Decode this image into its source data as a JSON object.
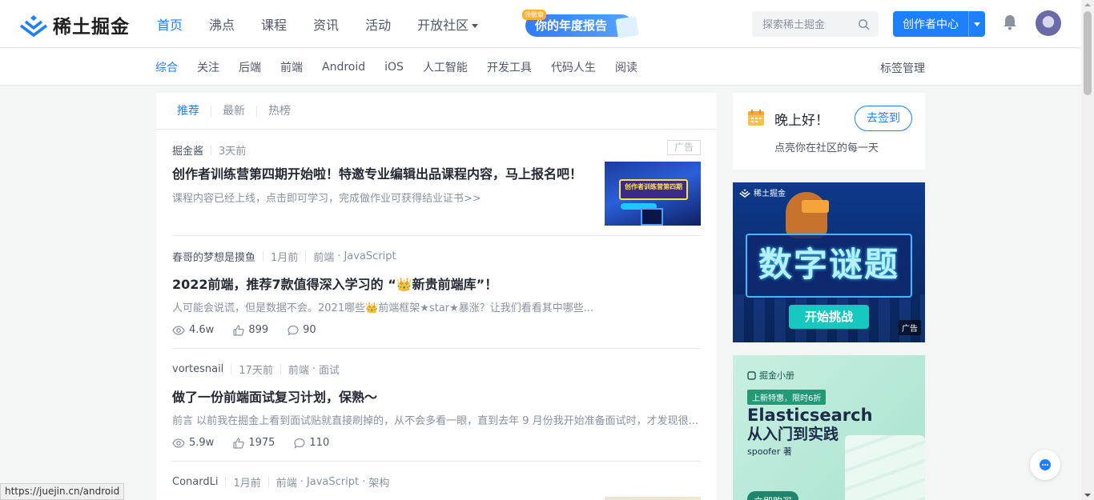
{
  "header": {
    "logo_text": "稀土掘金",
    "nav": [
      {
        "label": "首页",
        "active": true
      },
      {
        "label": "沸点",
        "active": false
      },
      {
        "label": "课程",
        "active": false
      },
      {
        "label": "资讯",
        "active": false
      },
      {
        "label": "活动",
        "active": false
      },
      {
        "label": "开放社区",
        "active": false,
        "dropdown": true
      }
    ],
    "year_report": {
      "badge": "领徽章",
      "label": "你的年度报告"
    },
    "search": {
      "placeholder": "探索稀土掘金",
      "icon": "search-icon"
    },
    "creator_button": "创作者中心",
    "notification_icon": "bell-icon",
    "accent_color": "#1e80ff"
  },
  "subnav": {
    "tags": [
      {
        "label": "综合",
        "active": true
      },
      {
        "label": "关注",
        "active": false
      },
      {
        "label": "后端",
        "active": false
      },
      {
        "label": "前端",
        "active": false
      },
      {
        "label": "Android",
        "active": false
      },
      {
        "label": "iOS",
        "active": false
      },
      {
        "label": "人工智能",
        "active": false
      },
      {
        "label": "开发工具",
        "active": false
      },
      {
        "label": "代码人生",
        "active": false
      },
      {
        "label": "阅读",
        "active": false
      }
    ],
    "manage": "标签管理"
  },
  "feed": {
    "tabs": [
      {
        "label": "推荐",
        "active": true
      },
      {
        "label": "最新",
        "active": false
      },
      {
        "label": "热榜",
        "active": false
      }
    ],
    "entries": [
      {
        "author": "掘金酱",
        "time": "3天前",
        "tags": [],
        "ad_label": "广告",
        "title": "创作者训练营第四期开始啦！特邀专业编辑出品课程内容，马上报名吧！",
        "abstract": "课程内容已经上线，点击即可学习，完成做作业可获得结业证书>>",
        "thumb_text": "创作者训练营第四期"
      },
      {
        "author": "春哥的梦想是摸鱼",
        "time": "1月前",
        "tags": [
          "前端",
          "JavaScript"
        ],
        "title": "2022前端，推荐7款值得深入学习的 “👑新贵前端库”！",
        "abstract": "人可能会说谎，但是数据不会。2021哪些👑前端框架★star★暴涨？让我们看看其中哪些...",
        "views": "4.6w",
        "likes": "899",
        "comments": "90"
      },
      {
        "author": "vortesnail",
        "time": "17天前",
        "tags": [
          "前端",
          "面试"
        ],
        "title": "做了一份前端面试复习计划，保熟～",
        "abstract": "前言 以前我在掘金上看到面试贴就直接刷掉的，从不会多看一眼，直到去年 9 月份我开始准备面试时，才发现很...",
        "views": "5.9w",
        "likes": "1975",
        "comments": "110"
      },
      {
        "author": "ConardLi",
        "time": "1月前",
        "tags": [
          "前端",
          "JavaScript",
          "架构"
        ]
      }
    ]
  },
  "sidebar": {
    "signin": {
      "greeting": "晚上好！",
      "subtitle": "点亮你在社区的每一天",
      "button": "去签到"
    },
    "ad1": {
      "brand": "稀土掘金",
      "headline": "数字谜题",
      "cta": "开始挑战",
      "ad_label": "广告"
    },
    "ad2": {
      "brand": "掘金小册",
      "promo": "上新特惠，限时6折",
      "title": "Elasticsearch",
      "subtitle": "从入门到实践",
      "author": "spoofer 著",
      "buy": "立即购买"
    }
  },
  "status_bar_url": "https://juejin.cn/android"
}
